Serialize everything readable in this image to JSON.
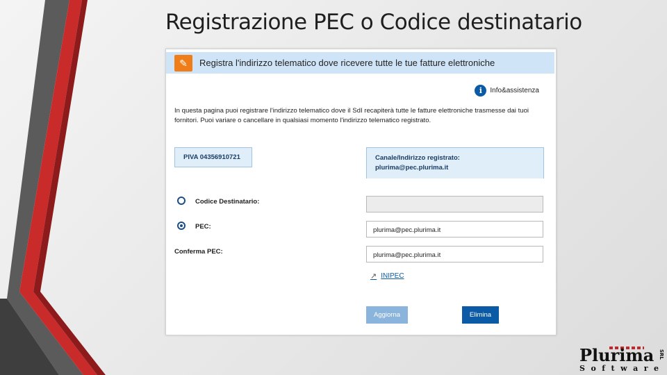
{
  "slide": {
    "title": "Registrazione PEC o Codice destinatario"
  },
  "panel": {
    "header_title": "Registra l'indirizzo telematico dove ricevere tutte le tue fatture elettroniche",
    "header_icon": "pencil-icon",
    "info_link": "Info&assistenza",
    "description": "In questa pagina puoi registrare l'indirizzo telematico dove il SdI recapiterà tutte le fatture elettroniche trasmesse dai tuoi fornitori. Puoi variare o cancellare in qualsiasi momento l'indirizzo telematico registrato.",
    "piva": "PIVA 04356910721",
    "canale_label": "Canale/Indirizzo registrato:",
    "canale_value": "plurima@pec.plurima.it",
    "codice_destinatario_label": "Codice Destinatario:",
    "codice_destinatario_value": "",
    "pec_label": "PEC:",
    "pec_value": "plurima@pec.plurima.it",
    "conferma_pec_label": "Conferma PEC:",
    "conferma_pec_value": "plurima@pec.plurima.it",
    "inipec_link": "INIPEC",
    "aggiorna_button": "Aggiorna",
    "elimina_button": "Elimina",
    "selected_option": "PEC"
  },
  "logo": {
    "main": "Plurima",
    "sub": "Software",
    "side": "SRL"
  },
  "colors": {
    "accent_orange": "#ef7d1a",
    "primary_blue": "#0b5aa5",
    "header_bg": "#cfe4f6",
    "deco_red": "#c0282d"
  }
}
